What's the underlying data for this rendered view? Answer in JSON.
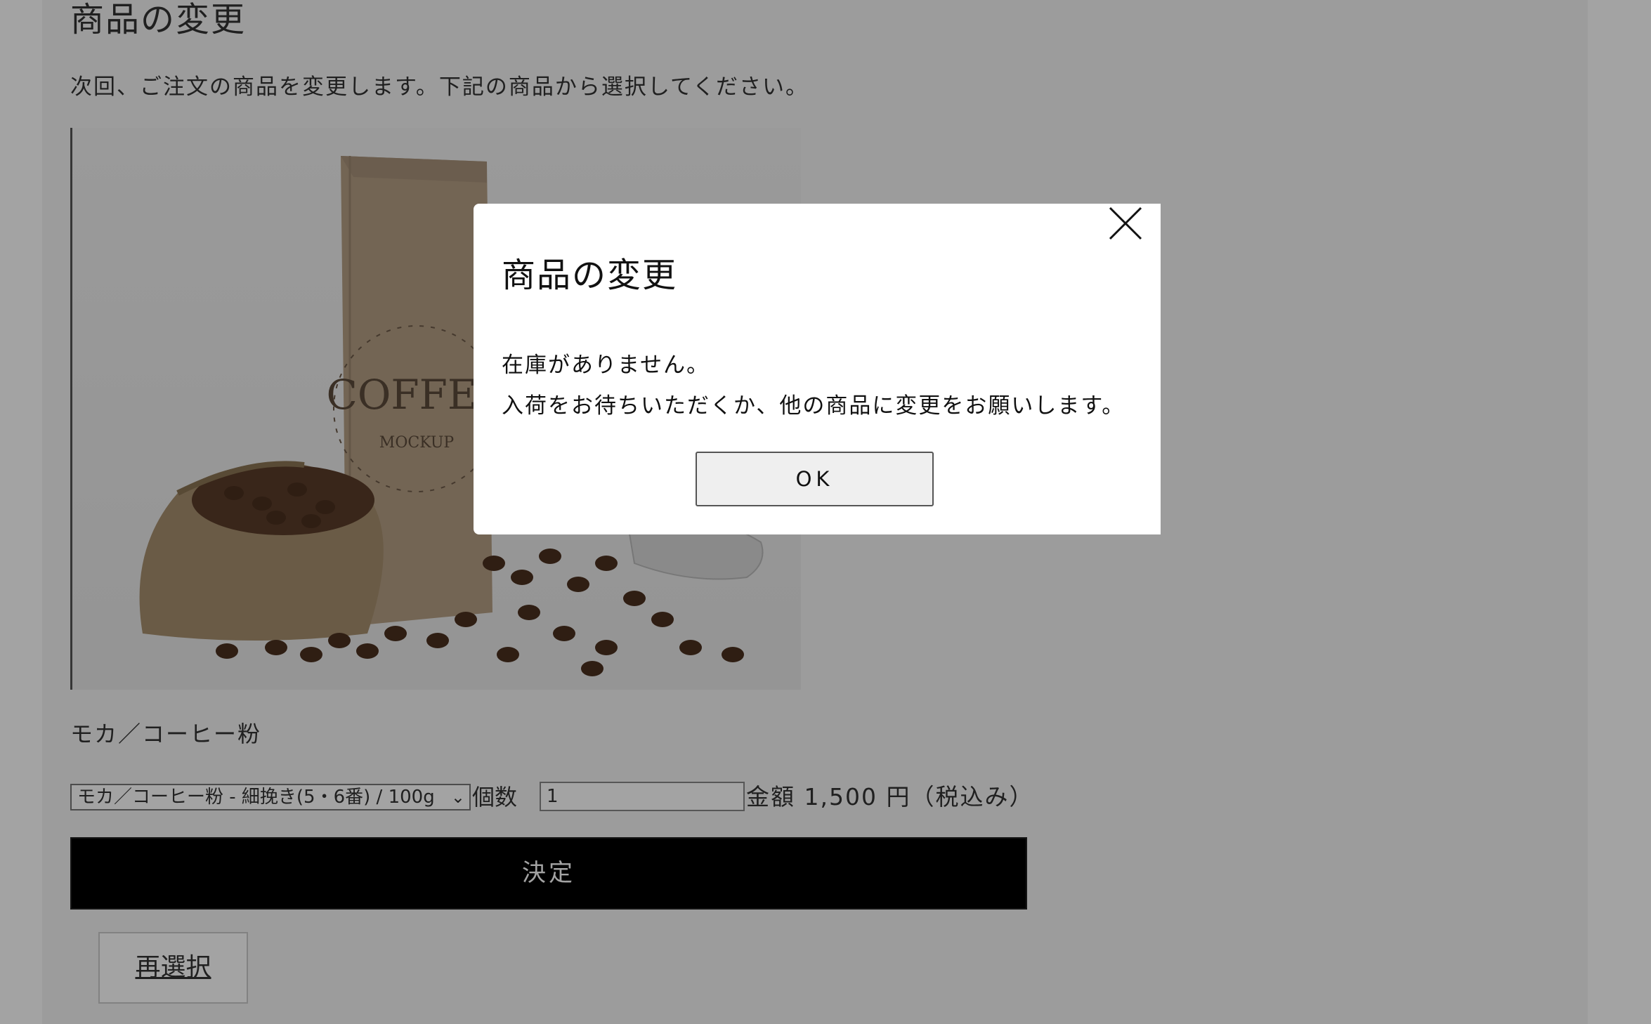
{
  "page": {
    "title": "商品の変更",
    "description": "次回、ご注文の商品を変更します。下記の商品から選択してください。",
    "product_name": "モカ／コーヒー粉",
    "variant_selected": "モカ／コーヒー粉 - 細挽き(5・6番) / 100g",
    "quantity_label": "個数",
    "quantity_value": "1",
    "price_text": "金額 1,500 円（税込み）",
    "decide_label": "決定",
    "reselect_label": "再選択",
    "image_label": "COFFEE",
    "image_sub_label": "MOCKUP"
  },
  "modal": {
    "title": "商品の変更",
    "message_line1": "在庫がありません。",
    "message_line2": "入荷をお待ちいただくか、他の商品に変更をお願いします。",
    "ok_label": "OK",
    "close_icon": "close-icon"
  },
  "colors": {
    "overlay": "rgba(0,0,0,0.36)",
    "decide_button": "#000000",
    "modal_bg": "#ffffff"
  }
}
